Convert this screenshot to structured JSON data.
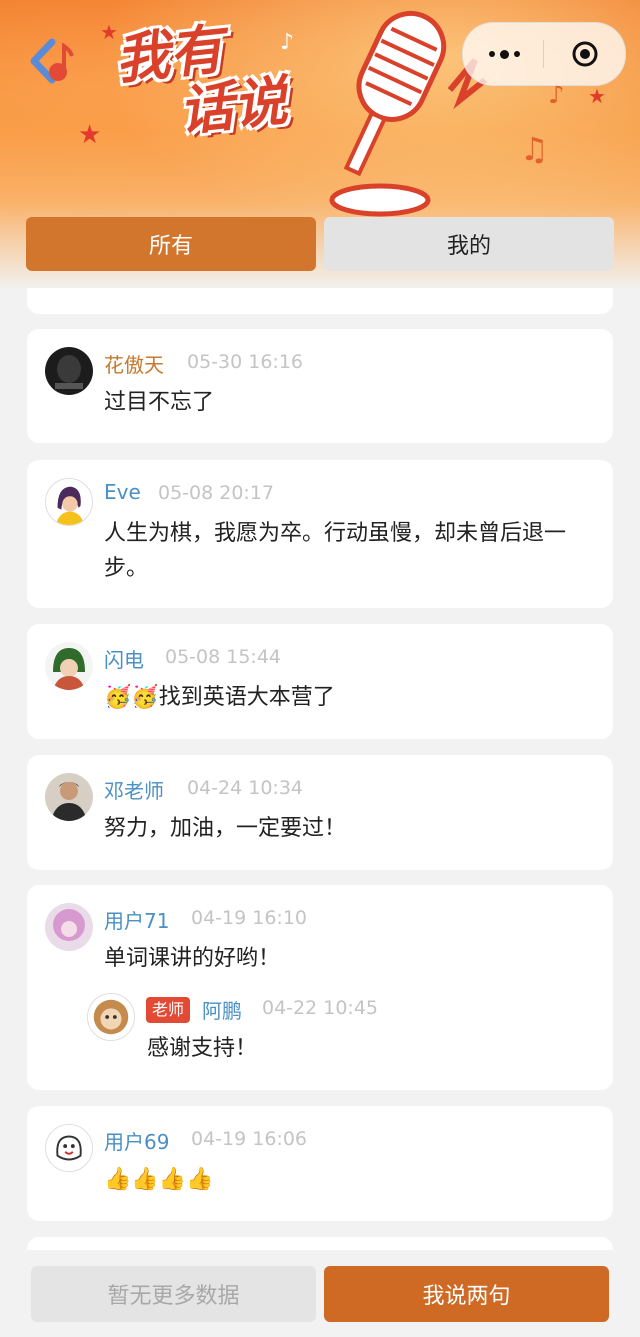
{
  "header": {
    "title_line1": "我有",
    "title_line2": "话说"
  },
  "tabs": [
    {
      "label": "所有",
      "active": true
    },
    {
      "label": "我的",
      "active": false
    }
  ],
  "comments": [
    {
      "name": "花傲天",
      "name_color": "#c8782e",
      "time": "05-30 16:16",
      "text": "过目不忘了",
      "avatar": "dark-dog-avatar"
    },
    {
      "name": "Eve",
      "name_color": "#4a90c4",
      "time": "05-08 20:17",
      "text": "人生为棋，我愿为卒。行动虽慢，却未曾后退一步。",
      "avatar": "girl-illustration-avatar"
    },
    {
      "name": "闪电",
      "name_color": "#4a90c4",
      "time": "05-08 15:44",
      "emoji": "🥳🥳",
      "text": "找到英语大本营了",
      "avatar": "green-hood-avatar"
    },
    {
      "name": "邓老师",
      "name_color": "#4a90c4",
      "time": "04-24 10:34",
      "text": "努力，加油，一定要过！",
      "avatar": "man-photo-avatar"
    },
    {
      "name": "用户71",
      "name_color": "#4a90c4",
      "time": "04-19 16:10",
      "text": "单词课讲的好哟！",
      "avatar": "pink-doll-avatar",
      "reply": {
        "badge": "老师",
        "name": "阿鹏",
        "time": "04-22 10:45",
        "text": "感谢支持！",
        "avatar": "lion-cartoon-avatar"
      }
    },
    {
      "name": "用户69",
      "name_color": "#4a90c4",
      "time": "04-19 16:06",
      "emoji": "👍👍👍👍",
      "text": "",
      "avatar": "cartoon-sketch-avatar"
    }
  ],
  "footer": {
    "no_more_label": "暂无更多数据",
    "say_label": "我说两句"
  },
  "colors": {
    "accent": "#d2762e",
    "button_primary": "#cf6a25",
    "name_blue": "#4a90c4",
    "name_orange": "#c8782e"
  }
}
